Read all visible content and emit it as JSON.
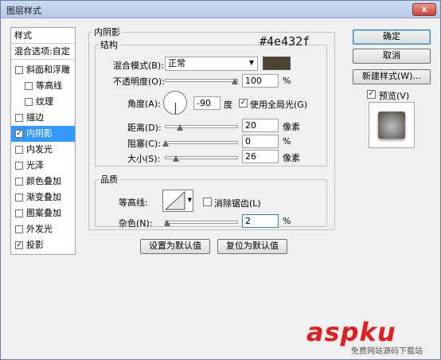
{
  "window": {
    "title": "图层样式",
    "close": "x"
  },
  "left_panel": {
    "header": "样式",
    "blend_options": "混合选项:自定",
    "items": [
      {
        "label": "斜面和浮雕",
        "checked": false
      },
      {
        "label": "等高线",
        "checked": false,
        "sub": true
      },
      {
        "label": "纹理",
        "checked": false,
        "sub": true
      },
      {
        "label": "描边",
        "checked": false
      },
      {
        "label": "内阴影",
        "checked": true,
        "selected": true
      },
      {
        "label": "内发光",
        "checked": false
      },
      {
        "label": "光泽",
        "checked": false
      },
      {
        "label": "颜色叠加",
        "checked": false
      },
      {
        "label": "渐变叠加",
        "checked": false
      },
      {
        "label": "图案叠加",
        "checked": false
      },
      {
        "label": "外发光",
        "checked": false
      },
      {
        "label": "投影",
        "checked": true
      }
    ]
  },
  "inner_shadow": {
    "group_title": "内阴影",
    "structure": {
      "title": "结构",
      "blend_mode_label": "混合模式(B):",
      "blend_mode_value": "正常",
      "color_hex": "#4e432f",
      "opacity_label": "不透明度(O):",
      "opacity_value": "100",
      "opacity_unit": "%",
      "angle_label": "角度(A):",
      "angle_value": "-90",
      "angle_unit": "度",
      "global_light_label": "使用全局光(G)",
      "global_light_checked": true,
      "distance_label": "距离(D):",
      "distance_value": "20",
      "distance_unit": "像素",
      "choke_label": "阻塞(C):",
      "choke_value": "0",
      "choke_unit": "%",
      "size_label": "大小(S):",
      "size_value": "26",
      "size_unit": "像素"
    },
    "quality": {
      "title": "品质",
      "contour_label": "等高线:",
      "antialias_label": "消除锯齿(L)",
      "antialias_checked": false,
      "noise_label": "杂色(N):",
      "noise_value": "2",
      "noise_unit": "%"
    },
    "make_default": "设置为默认值",
    "reset_default": "复位为默认值"
  },
  "annotation": "#4e432f",
  "right_panel": {
    "ok": "确定",
    "cancel": "取消",
    "new_style": "新建样式(W)...",
    "preview_label": "预览(V)",
    "preview_checked": true
  },
  "watermark": {
    "text": "aspku",
    "sub": "免费网站源码下载站"
  },
  "colors": {
    "shadow": "#4e432f",
    "selected": "#3399ff"
  }
}
